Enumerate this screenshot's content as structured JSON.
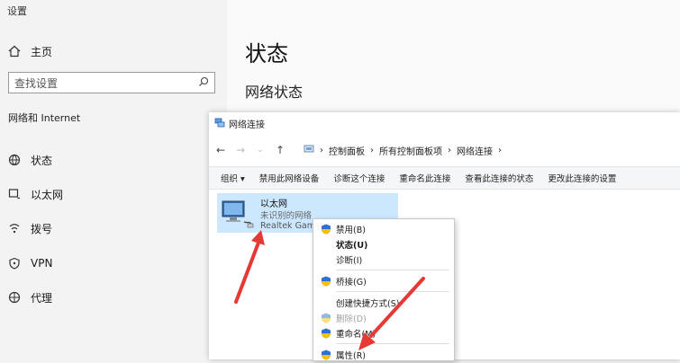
{
  "settings": {
    "window_title": "设置",
    "home_label": "主页",
    "search_placeholder": "查找设置",
    "section_label": "网络和 Internet",
    "nav_items": [
      {
        "label": "状态",
        "icon": "globe-status-icon"
      },
      {
        "label": "以太网",
        "icon": "ethernet-icon"
      },
      {
        "label": "拨号",
        "icon": "dialup-icon"
      },
      {
        "label": "VPN",
        "icon": "vpn-icon"
      },
      {
        "label": "代理",
        "icon": "proxy-globe-icon"
      }
    ],
    "page_title": "状态",
    "page_subtitle": "网络状态"
  },
  "explorer": {
    "window_title": "网络连接",
    "breadcrumbs": [
      "控制面板",
      "所有控制面板项",
      "网络连接"
    ],
    "commands": [
      "组织 ▾",
      "禁用此网络设备",
      "诊断这个连接",
      "重命名此连接",
      "查看此连接的状态",
      "更改此连接的设置"
    ],
    "item": {
      "name": "以太网",
      "status": "未识别的网络",
      "adapter": "Realtek Gam"
    }
  },
  "context_menu": {
    "items": [
      {
        "label": "禁用(B)",
        "shield": true,
        "bold": false,
        "disabled": false
      },
      {
        "label": "状态(U)",
        "shield": false,
        "bold": true,
        "disabled": false
      },
      {
        "label": "诊断(I)",
        "shield": false,
        "bold": false,
        "disabled": false
      },
      {
        "label": "桥接(G)",
        "shield": true,
        "bold": false,
        "disabled": false
      },
      {
        "label": "创建快捷方式(S)",
        "shield": false,
        "bold": false,
        "disabled": false
      },
      {
        "label": "删除(D)",
        "shield": true,
        "bold": false,
        "disabled": true
      },
      {
        "label": "重命名(M)",
        "shield": true,
        "bold": false,
        "disabled": false
      },
      {
        "label": "属性(R)",
        "shield": true,
        "bold": false,
        "disabled": false
      }
    ]
  },
  "colors": {
    "annotation_arrow": "#e53935",
    "selection": "#cce8ff",
    "shield_blue": "#2f6fd6",
    "shield_yellow": "#f2c200"
  }
}
